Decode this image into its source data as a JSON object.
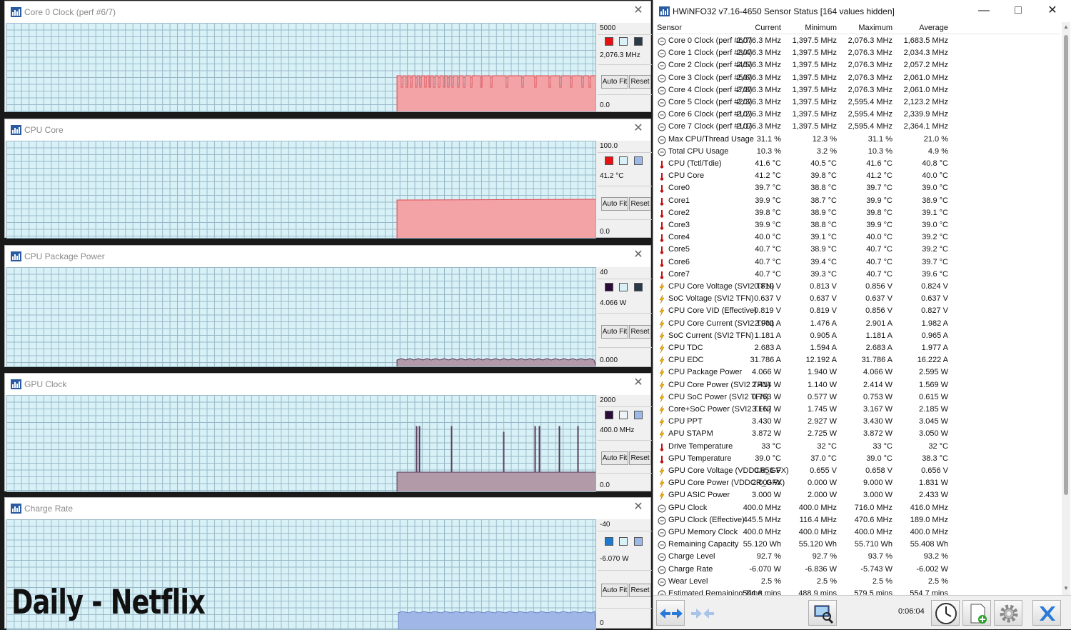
{
  "graphs": [
    {
      "title": "Core 0 Clock (perf #6/7)",
      "max": "5000",
      "current": "2,076.3 MHz",
      "min": "0.0",
      "swatches": [
        "#e81010",
        "#d7f1f7",
        "#2a3a48"
      ]
    },
    {
      "title": "CPU Core",
      "max": "100.0",
      "current": "41.2 °C",
      "min": "0.0",
      "swatches": [
        "#e81010",
        "#d7f1f7",
        "#9ab9e8"
      ]
    },
    {
      "title": "CPU Package Power",
      "max": "40",
      "current": "4.066 W",
      "min": "0.000",
      "swatches": [
        "#2b0b3a",
        "#d7f1f7",
        "#2a3a48"
      ]
    },
    {
      "title": "GPU Clock",
      "max": "2000",
      "current": "400.0 MHz",
      "min": "0.0",
      "swatches": [
        "#2b0b3a",
        "#eef3f8",
        "#9ab9e8"
      ]
    },
    {
      "title": "Charge Rate",
      "max": "-40",
      "current": "-6.070 W",
      "min": "0",
      "swatches": [
        "#1c7ad0",
        "#d7f1f7",
        "#9ab9e8"
      ]
    }
  ],
  "buttons": {
    "autofit": "Auto Fit",
    "reset": "Reset"
  },
  "overlay_text": "Daily - Netflix",
  "window": {
    "title": "HWiNFO32 v7.16-4650 Sensor Status [164 values hidden]"
  },
  "columns": {
    "sensor": "Sensor",
    "current": "Current",
    "minimum": "Minimum",
    "maximum": "Maximum",
    "average": "Average"
  },
  "rows": [
    {
      "icon": "clock",
      "name": "Core 0 Clock (perf #6/7)",
      "cur": "2,076.3 MHz",
      "min": "1,397.5 MHz",
      "max": "2,076.3 MHz",
      "avg": "1,683.5 MHz"
    },
    {
      "icon": "clock",
      "name": "Core 1 Clock (perf #3/4)",
      "cur": "2,076.3 MHz",
      "min": "1,397.5 MHz",
      "max": "2,076.3 MHz",
      "avg": "2,034.3 MHz"
    },
    {
      "icon": "clock",
      "name": "Core 2 Clock (perf #4/5)",
      "cur": "2,076.3 MHz",
      "min": "1,397.5 MHz",
      "max": "2,076.3 MHz",
      "avg": "2,057.2 MHz"
    },
    {
      "icon": "clock",
      "name": "Core 3 Clock (perf #5/6)",
      "cur": "2,076.3 MHz",
      "min": "1,397.5 MHz",
      "max": "2,076.3 MHz",
      "avg": "2,061.0 MHz"
    },
    {
      "icon": "clock",
      "name": "Core 4 Clock (perf #7/8)",
      "cur": "2,076.3 MHz",
      "min": "1,397.5 MHz",
      "max": "2,076.3 MHz",
      "avg": "2,061.0 MHz"
    },
    {
      "icon": "clock",
      "name": "Core 5 Clock (perf #2/3)",
      "cur": "2,076.3 MHz",
      "min": "1,397.5 MHz",
      "max": "2,595.4 MHz",
      "avg": "2,123.2 MHz"
    },
    {
      "icon": "clock",
      "name": "Core 6 Clock (perf #1/2)",
      "cur": "2,076.3 MHz",
      "min": "1,397.5 MHz",
      "max": "2,595.4 MHz",
      "avg": "2,339.9 MHz"
    },
    {
      "icon": "clock",
      "name": "Core 7 Clock (perf #1/1)",
      "cur": "2,076.3 MHz",
      "min": "1,397.5 MHz",
      "max": "2,595.4 MHz",
      "avg": "2,364.1 MHz"
    },
    {
      "icon": "clock",
      "name": "Max CPU/Thread Usage",
      "cur": "31.1 %",
      "min": "12.3 %",
      "max": "31.1 %",
      "avg": "21.0 %"
    },
    {
      "icon": "clock",
      "name": "Total CPU Usage",
      "cur": "10.3 %",
      "min": "3.2 %",
      "max": "10.3 %",
      "avg": "4.9 %"
    },
    {
      "icon": "temp",
      "name": "CPU (Tctl/Tdie)",
      "cur": "41.6 °C",
      "min": "40.5 °C",
      "max": "41.6 °C",
      "avg": "40.8 °C"
    },
    {
      "icon": "temp",
      "name": "CPU Core",
      "cur": "41.2 °C",
      "min": "39.8 °C",
      "max": "41.2 °C",
      "avg": "40.0 °C"
    },
    {
      "icon": "temp",
      "name": "Core0",
      "cur": "39.7 °C",
      "min": "38.8 °C",
      "max": "39.7 °C",
      "avg": "39.0 °C"
    },
    {
      "icon": "temp",
      "name": "Core1",
      "cur": "39.9 °C",
      "min": "38.7 °C",
      "max": "39.9 °C",
      "avg": "38.9 °C"
    },
    {
      "icon": "temp",
      "name": "Core2",
      "cur": "39.8 °C",
      "min": "38.9 °C",
      "max": "39.8 °C",
      "avg": "39.1 °C"
    },
    {
      "icon": "temp",
      "name": "Core3",
      "cur": "39.9 °C",
      "min": "38.8 °C",
      "max": "39.9 °C",
      "avg": "39.0 °C"
    },
    {
      "icon": "temp",
      "name": "Core4",
      "cur": "40.0 °C",
      "min": "39.1 °C",
      "max": "40.0 °C",
      "avg": "39.2 °C"
    },
    {
      "icon": "temp",
      "name": "Core5",
      "cur": "40.7 °C",
      "min": "38.9 °C",
      "max": "40.7 °C",
      "avg": "39.2 °C"
    },
    {
      "icon": "temp",
      "name": "Core6",
      "cur": "40.7 °C",
      "min": "39.4 °C",
      "max": "40.7 °C",
      "avg": "39.7 °C"
    },
    {
      "icon": "temp",
      "name": "Core7",
      "cur": "40.7 °C",
      "min": "39.3 °C",
      "max": "40.7 °C",
      "avg": "39.6 °C"
    },
    {
      "icon": "bolt",
      "name": "CPU Core Voltage (SVI2 TFN)",
      "cur": "0.819 V",
      "min": "0.813 V",
      "max": "0.856 V",
      "avg": "0.824 V"
    },
    {
      "icon": "bolt",
      "name": "SoC Voltage (SVI2 TFN)",
      "cur": "0.637 V",
      "min": "0.637 V",
      "max": "0.637 V",
      "avg": "0.637 V"
    },
    {
      "icon": "bolt",
      "name": "CPU Core VID (Effective)",
      "cur": "0.819 V",
      "min": "0.819 V",
      "max": "0.856 V",
      "avg": "0.827 V"
    },
    {
      "icon": "bolt",
      "name": "CPU Core Current (SVI2 TFN)",
      "cur": "2.901 A",
      "min": "1.476 A",
      "max": "2.901 A",
      "avg": "1.982 A"
    },
    {
      "icon": "bolt",
      "name": "SoC Current (SVI2 TFN)",
      "cur": "1.181 A",
      "min": "0.905 A",
      "max": "1.181 A",
      "avg": "0.965 A"
    },
    {
      "icon": "bolt",
      "name": "CPU TDC",
      "cur": "2.683 A",
      "min": "1.594 A",
      "max": "2.683 A",
      "avg": "1.977 A"
    },
    {
      "icon": "bolt",
      "name": "CPU EDC",
      "cur": "31.786 A",
      "min": "12.192 A",
      "max": "31.786 A",
      "avg": "16.222 A"
    },
    {
      "icon": "bolt",
      "name": "CPU Package Power",
      "cur": "4.066 W",
      "min": "1.940 W",
      "max": "4.066 W",
      "avg": "2.595 W"
    },
    {
      "icon": "bolt",
      "name": "CPU Core Power (SVI2 TFN)",
      "cur": "2.414 W",
      "min": "1.140 W",
      "max": "2.414 W",
      "avg": "1.569 W"
    },
    {
      "icon": "bolt",
      "name": "CPU SoC Power (SVI2 TFN)",
      "cur": "0.753 W",
      "min": "0.577 W",
      "max": "0.753 W",
      "avg": "0.615 W"
    },
    {
      "icon": "bolt",
      "name": "Core+SoC Power (SVI2 TFN)",
      "cur": "3.167 W",
      "min": "1.745 W",
      "max": "3.167 W",
      "avg": "2.185 W"
    },
    {
      "icon": "bolt",
      "name": "CPU PPT",
      "cur": "3.430 W",
      "min": "2.927 W",
      "max": "3.430 W",
      "avg": "3.045 W"
    },
    {
      "icon": "bolt",
      "name": "APU STAPM",
      "cur": "3.872 W",
      "min": "2.725 W",
      "max": "3.872 W",
      "avg": "3.050 W"
    },
    {
      "icon": "temp",
      "name": "Drive Temperature",
      "cur": "33 °C",
      "min": "32 °C",
      "max": "33 °C",
      "avg": "32 °C"
    },
    {
      "icon": "temp",
      "name": "GPU Temperature",
      "cur": "39.0 °C",
      "min": "37.0 °C",
      "max": "39.0 °C",
      "avg": "38.3 °C"
    },
    {
      "icon": "bolt",
      "name": "GPU Core Voltage (VDDCR_GFX)",
      "cur": "0.658 V",
      "min": "0.655 V",
      "max": "0.658 V",
      "avg": "0.656 V"
    },
    {
      "icon": "bolt",
      "name": "GPU Core Power (VDDCR_GFX)",
      "cur": "2.000 W",
      "min": "0.000 W",
      "max": "9.000 W",
      "avg": "1.831 W"
    },
    {
      "icon": "bolt",
      "name": "GPU ASIC Power",
      "cur": "3.000 W",
      "min": "2.000 W",
      "max": "3.000 W",
      "avg": "2.433 W"
    },
    {
      "icon": "clock",
      "name": "GPU Clock",
      "cur": "400.0 MHz",
      "min": "400.0 MHz",
      "max": "716.0 MHz",
      "avg": "416.0 MHz"
    },
    {
      "icon": "clock",
      "name": "GPU Clock (Effective)",
      "cur": "445.5 MHz",
      "min": "116.4 MHz",
      "max": "470.6 MHz",
      "avg": "189.0 MHz"
    },
    {
      "icon": "clock",
      "name": "GPU Memory Clock",
      "cur": "400.0 MHz",
      "min": "400.0 MHz",
      "max": "400.0 MHz",
      "avg": "400.0 MHz"
    },
    {
      "icon": "clock",
      "name": "Remaining Capacity",
      "cur": "55.120 Wh",
      "min": "55.120 Wh",
      "max": "55.710 Wh",
      "avg": "55.408 Wh"
    },
    {
      "icon": "clock",
      "name": "Charge Level",
      "cur": "92.7 %",
      "min": "92.7 %",
      "max": "93.7 %",
      "avg": "93.2 %"
    },
    {
      "icon": "clock",
      "name": "Charge Rate",
      "cur": "-6.070 W",
      "min": "-6.836 W",
      "max": "-5.743 W",
      "avg": "-6.002 W"
    },
    {
      "icon": "clock",
      "name": "Wear Level",
      "cur": "2.5 %",
      "min": "2.5 %",
      "max": "2.5 %",
      "avg": "2.5 %"
    },
    {
      "icon": "clock",
      "name": "Estimated Remaining Time",
      "cur": "544.8 mins",
      "min": "488.9 mins",
      "max": "579.5 mins",
      "avg": "554.7 mins"
    }
  ],
  "timer": "0:06:04",
  "colors": {
    "plot_bg": "#d7f1f7",
    "red_fill": "#f3a3a6",
    "red_line": "#e04a52",
    "purple_fill": "#b39aa8",
    "purple_line": "#5a3a5a",
    "blue_fill": "#9fb6e6",
    "blue_line": "#6a86c8"
  }
}
